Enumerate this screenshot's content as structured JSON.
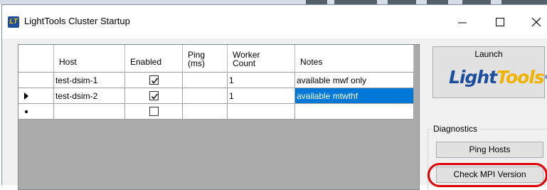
{
  "window": {
    "title": "LightTools Cluster Startup",
    "icon_text": "LT",
    "minimize_icon": "minimize-icon",
    "maximize_icon": "maximize-icon",
    "close_icon": "close-icon"
  },
  "grid": {
    "columns": [
      "Host",
      "Enabled",
      "Ping\n(ms)",
      "Worker\nCount",
      "Notes"
    ],
    "rows": [
      {
        "host": "test-dsim-1",
        "enabled": true,
        "ping": "",
        "worker_count": "1",
        "notes": "available mwf only",
        "indicator": "",
        "selected": false
      },
      {
        "host": "test-dsim-2",
        "enabled": true,
        "ping": "",
        "worker_count": "1",
        "notes": "available mtwthf",
        "indicator": "current-row-arrow",
        "selected": true
      },
      {
        "host": "",
        "enabled": false,
        "ping": "",
        "worker_count": "",
        "notes": "",
        "indicator": "new-row-star",
        "selected": false
      }
    ]
  },
  "launch": {
    "label": "Launch",
    "logo_text_main": "Light",
    "logo_text_accent": "Tools",
    "logo_mark": "®"
  },
  "diagnostics": {
    "group_label": "Diagnostics",
    "ping_hosts_label": "Ping Hosts",
    "check_mpi_label": "Check MPI Version"
  },
  "colors": {
    "selection": "#0078d7",
    "highlight_ring": "#e00000",
    "logo_blue": "#1c4ea0",
    "logo_gold": "#f0b300"
  }
}
